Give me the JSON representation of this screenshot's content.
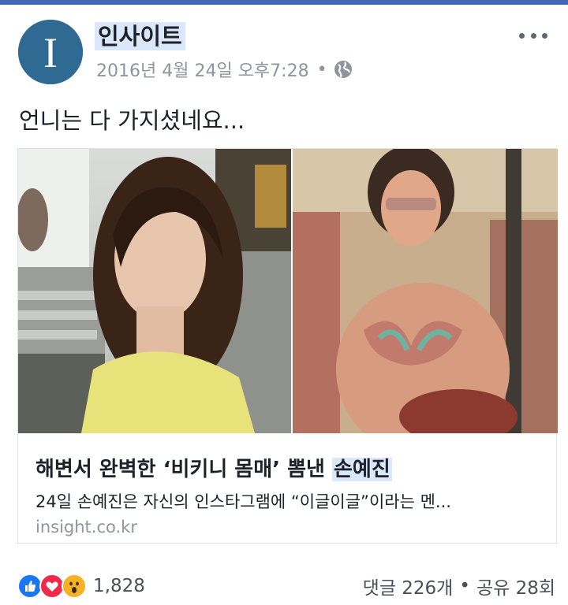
{
  "post": {
    "page_name": "인사이트",
    "timestamp": "2016년 4월 24일 오후7:28",
    "separator": "•",
    "privacy_icon": "globe-icon",
    "more_icon": "more-options-icon",
    "avatar_letter": "I",
    "text": "언니는 다 가지셨네요..."
  },
  "link": {
    "title_main": "해변서 완벽한 ‘비키니 몸매’ 뽐낸",
    "title_highlight": "손예진",
    "description": "24일 손예진은 자신의 인스타그램에 “이글이글”이라는 멘...",
    "domain": "insight.co.kr"
  },
  "footer": {
    "reaction_icons": [
      "like-icon",
      "love-icon",
      "wow-icon"
    ],
    "reaction_count": "1,828",
    "comments": "댓글 226개",
    "separator": "•",
    "shares": "공유 28회"
  },
  "colors": {
    "facebook_blue": "#4267b2",
    "avatar_bg": "#2f6a93",
    "highlight": "#dbe7fb",
    "like": "#1877f2",
    "love": "#f0284a",
    "wow": "#f7b125",
    "meta_gray": "#90949c"
  }
}
